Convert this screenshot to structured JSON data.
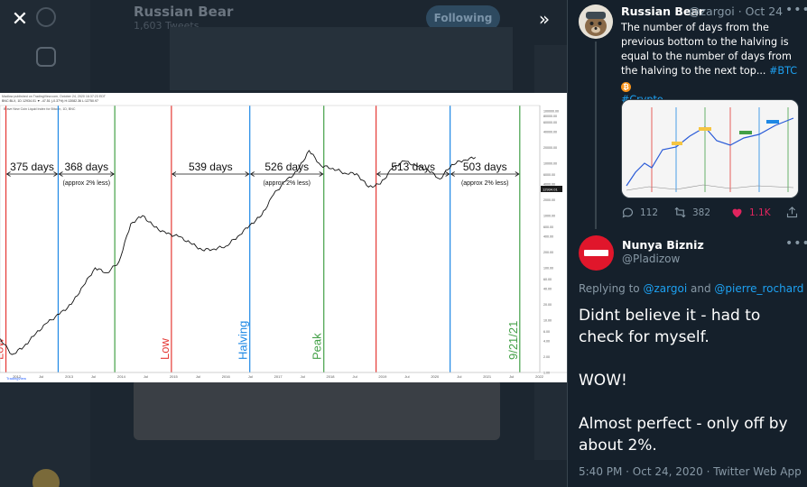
{
  "background": {
    "account_name": "Russian Bear",
    "tweets_count": "1,603 Tweets",
    "follow_label": "Following"
  },
  "overlay": {
    "close_icon": "close-icon",
    "collapse_icon": "double-chevron-right-icon"
  },
  "chart_image": {
    "header_line1": "Madlow published on TradingView.com, October 24, 2020 16:37:23 EDT",
    "header_line2": "BNC:BLX, 1D  12934.01 ▼ -47.51 (-0.37%) H:13082.36 L:12750.97",
    "header_line3": "Brave New Coin Liquid Index for Bitcoin, 1D, BNC",
    "price_tag": "12934.01",
    "footer_brand": "TradingView",
    "chart_data": {
      "type": "line",
      "title": "",
      "ylabel": "",
      "xlabel": "",
      "log_scale": true,
      "x_ticks": [
        "2012",
        "Jul",
        "2013",
        "Jul",
        "2014",
        "Jul",
        "2015",
        "Jul",
        "2016",
        "Jul",
        "2017",
        "Jul",
        "2018",
        "Jul",
        "2019",
        "Jul",
        "2020",
        "Jul",
        "2021",
        "Jul",
        "2022"
      ],
      "y_ticks": [
        "100000.00",
        "80000.00",
        "60000.00",
        "40000.00",
        "20000.00",
        "10000.00",
        "6000.00",
        "4000.00",
        "2000.00",
        "1000.00",
        "600.00",
        "400.00",
        "200.00",
        "100.00",
        "60.00",
        "40.00",
        "20.00",
        "10.00",
        "6.00",
        "4.00",
        "2.00",
        "1.00"
      ],
      "vertical_lines": [
        {
          "label": "Low",
          "color": "#e53935",
          "x": "2011-11"
        },
        {
          "label": "",
          "color": "#1e88e5",
          "x": "2012-11"
        },
        {
          "label": "",
          "color": "#43a047",
          "x": "2013-12"
        },
        {
          "label": "Low",
          "color": "#e53935",
          "x": "2015-01"
        },
        {
          "label": "Halving",
          "color": "#1e88e5",
          "x": "2016-07"
        },
        {
          "label": "Peak",
          "color": "#43a047",
          "x": "2017-12"
        },
        {
          "label": "",
          "color": "#e53935",
          "x": "2018-12"
        },
        {
          "label": "",
          "color": "#1e88e5",
          "x": "2020-05"
        },
        {
          "label": "9/21/21",
          "color": "#43a047",
          "x": "2021-09"
        }
      ],
      "annotations": [
        {
          "text": "375 days"
        },
        {
          "text": "368 days",
          "note": "(approx 2% less)"
        },
        {
          "text": "539 days"
        },
        {
          "text": "526 days",
          "note": "(approx 2% less)"
        },
        {
          "text": "513 days"
        },
        {
          "text": "503 days",
          "note": "(approx 2% less)"
        }
      ],
      "series": [
        {
          "values": [
            4.5,
            2.2,
            3.1,
            5.5,
            9,
            13,
            20,
            45,
            100,
            80,
            130,
            700,
            1000,
            600,
            450,
            400,
            300,
            220,
            230,
            260,
            400,
            650,
            1000,
            2500,
            4500,
            7000,
            17500,
            9000,
            8000,
            6500,
            6300,
            3500,
            4000,
            8000,
            11000,
            9000,
            7500,
            5000,
            9500,
            11500,
            12934
          ]
        }
      ]
    }
  },
  "tweet1": {
    "name": "Russian Bear",
    "handle": "@zargoi",
    "date": "Oct 24",
    "text": "The number of days from the previous bottom to the halving is equal to the number of days from the halving to the next top...",
    "hashtag1": "#BTC",
    "hashtag2": "#Crypto",
    "replies": "112",
    "retweets": "382",
    "likes": "1.1K"
  },
  "tweet2": {
    "name": "Nunya Bizniz",
    "handle": "@Pladizow",
    "replying_prefix": "Replying to",
    "replying_to1": "@zargoi",
    "replying_and": "and",
    "replying_to2": "@pierre_rochard",
    "line1": "Didnt believe it - had to check for myself.",
    "line2": "WOW!",
    "line3": "Almost perfect - only off by about 2%.",
    "time": "5:40 PM · Oct 24, 2020",
    "source": "Twitter Web App"
  },
  "colors": {
    "link": "#1da1f2",
    "like": "#e0245e",
    "low_line": "#e53935",
    "halving_line": "#1e88e5",
    "peak_line": "#43a047"
  }
}
